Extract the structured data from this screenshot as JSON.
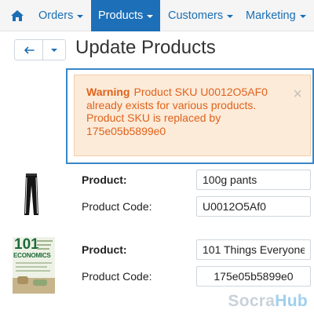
{
  "nav": {
    "home_icon": "home-icon",
    "items": [
      {
        "label": "Orders",
        "active": false
      },
      {
        "label": "Products",
        "active": true
      },
      {
        "label": "Customers",
        "active": false
      },
      {
        "label": "Marketing",
        "active": false
      }
    ]
  },
  "header": {
    "back_icon": "arrow-left-icon",
    "dropdown_icon": "caret-down-icon",
    "title": "Update Products"
  },
  "alert": {
    "label": "Warning",
    "message": "Product SKU U0012O5AF0 already exists for various products. Product SKU is replaced by 175e05b5899e0",
    "close_icon": "close-icon",
    "color": "#e0621b"
  },
  "products": [
    {
      "image": "pants-thumbnail",
      "product_label": "Product:",
      "product_value": "100g pants",
      "code_label": "Product Code:",
      "code_value": "U0012O5Af0"
    },
    {
      "image": "book-cover-thumbnail",
      "cover_title_top": "101",
      "cover_title_bottom": "ECONOMICS",
      "product_label": "Product:",
      "product_value": "101 Things Everyone",
      "code_label": "Product Code:",
      "code_value": "175e05b5899e0"
    }
  ],
  "watermark": {
    "prefix": "Socra",
    "suffix": "Hub"
  },
  "colors": {
    "accent": "#1d6fb8",
    "link": "#1a6fb5",
    "warning_bg": "#fcebd9",
    "warning_text": "#e0621b"
  }
}
